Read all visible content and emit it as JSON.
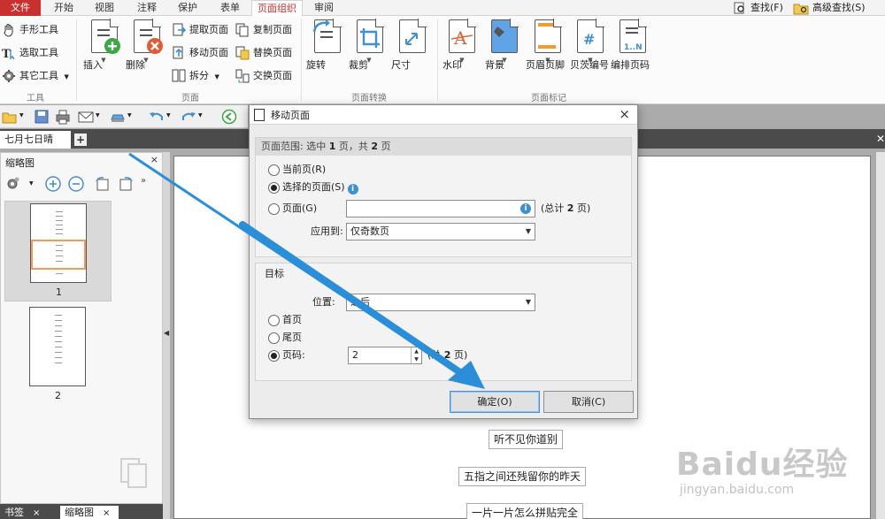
{
  "ribbon_tabs": [
    "文件",
    "开始",
    "视图",
    "注释",
    "保护",
    "表单",
    "页面组织",
    "审阅"
  ],
  "search": {
    "find_label": "查找(F)",
    "advanced_label": "高级查找(S)"
  },
  "tools_group": {
    "hand": "手形工具",
    "select": "选取工具",
    "other": "其它工具",
    "label": "工具"
  },
  "page_group": {
    "insert": "插入",
    "delete": "删除",
    "extract": "提取页面",
    "move": "移动页面",
    "split": "拆分",
    "copy": "复制页面",
    "replace": "替换页面",
    "swap": "交换页面",
    "label": "页面"
  },
  "transform_group": {
    "rotate": "旋转",
    "crop": "裁剪",
    "size": "尺寸",
    "label": "页面转换"
  },
  "mark_group": {
    "watermark": "水印",
    "background": "背景",
    "header_footer": "页眉页脚",
    "bates": "贝茨编号",
    "page_number": "编排页码",
    "label": "页面标记"
  },
  "doc_tab": {
    "name": "七月七日晴",
    "add": "+"
  },
  "thumb_panel": {
    "title": "缩略图",
    "close": "×",
    "pages": [
      "1",
      "2"
    ]
  },
  "bottom_tabs": {
    "bookmarks": "书签",
    "thumbnails": "缩略图",
    "close": "×"
  },
  "dialog": {
    "title": "移动页面",
    "close": "×",
    "range_header_prefix": "页面范围: 选中",
    "range_selected": "1",
    "range_mid": "页，共",
    "range_total": "2",
    "range_suffix": "页",
    "opt_current": "当前页(R)",
    "opt_selected": "选择的页面(S)",
    "opt_pages": "页面(G)",
    "pages_value": "",
    "total_prefix": "(总计",
    "total_value": "2",
    "total_suffix": "页)",
    "apply_label": "应用到:",
    "apply_value": "仅奇数页",
    "target_header": "目标",
    "position_label": "位置:",
    "position_value": "之后",
    "opt_first": "首页",
    "opt_last": "尾页",
    "opt_pagenum": "页码:",
    "pagenum_value": "2",
    "total2_prefix": "(总",
    "total2_value": "2",
    "total2_suffix": "页)",
    "ok": "确定(O)",
    "cancel": "取消(C)"
  },
  "document_lines": [
    "听不见你道别",
    "五指之间还残留你的昨天",
    "一片一片怎么拼贴完全"
  ],
  "watermark": {
    "brand": "Baidu经验",
    "url": "jingyan.baidu.com"
  },
  "colors": {
    "accent_red": "#c8312d",
    "arrow_blue": "#2a8fd8",
    "info_blue": "#3f8fd6",
    "thumb_highlight": "#f29a5a"
  }
}
